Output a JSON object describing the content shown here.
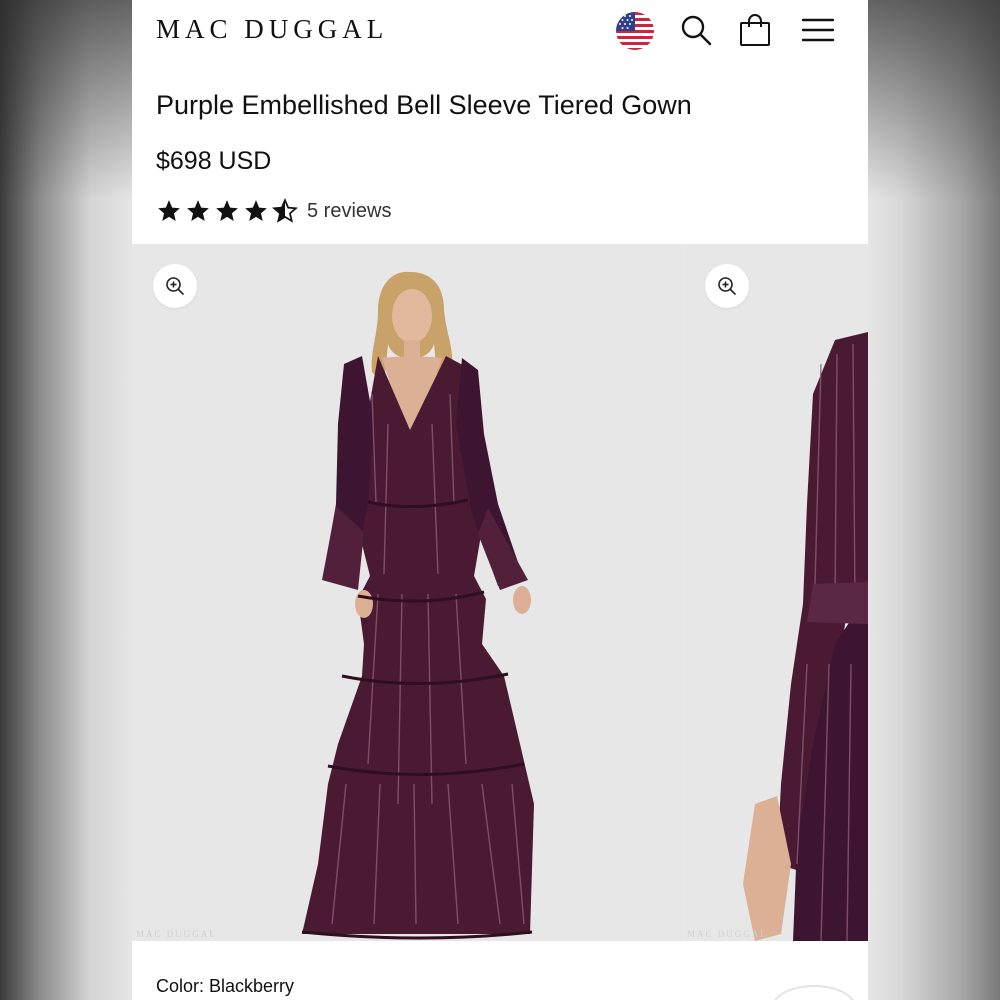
{
  "brand": {
    "logo": "MAC DUGGAL"
  },
  "header_icons": [
    "us-flag-icon",
    "search-icon",
    "shopping-bag-icon",
    "menu-icon"
  ],
  "product": {
    "title": "Purple Embellished Bell Sleeve Tiered Gown",
    "price": "$698 USD",
    "rating": 4.5,
    "rating_max": 5,
    "reviews_label": "5 reviews",
    "color_label": "Color:",
    "color_value": "Blackberry"
  },
  "gallery": {
    "image_count_visible": 2,
    "zoom_icon": "zoom-in-icon",
    "dress_color": "#4a1a33",
    "watermark": "MAC DUGGAL"
  }
}
